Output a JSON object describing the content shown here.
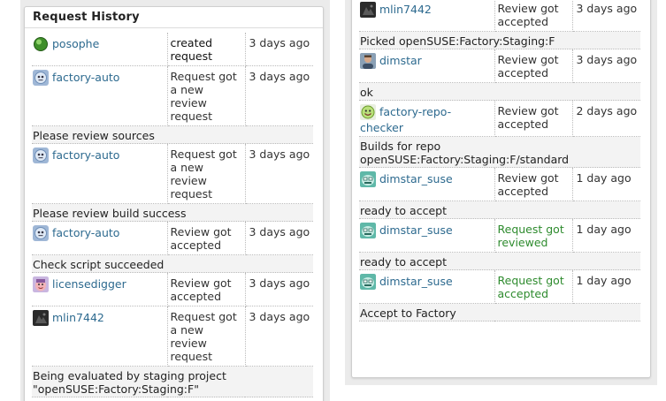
{
  "panel": {
    "title": "Request History"
  },
  "left_entries": [
    {
      "kind": "event",
      "user": "posophe",
      "avatar": "green-orb-icon",
      "desc": "created request",
      "desc_style": "dark",
      "when": "3 days ago"
    },
    {
      "kind": "event",
      "user": "factory-auto",
      "avatar": "bot-face-icon",
      "desc": "Request got a new review request",
      "desc_style": "",
      "when": "3 days ago"
    },
    {
      "kind": "comment",
      "text": "Please review sources"
    },
    {
      "kind": "event",
      "user": "factory-auto",
      "avatar": "bot-face-icon",
      "desc": "Request got a new review request",
      "desc_style": "",
      "when": "3 days ago"
    },
    {
      "kind": "comment",
      "text": "Please review build success"
    },
    {
      "kind": "event",
      "user": "factory-auto",
      "avatar": "bot-face-icon",
      "desc": "Review got accepted",
      "desc_style": "",
      "when": "3 days ago"
    },
    {
      "kind": "comment",
      "text": "Check script succeeded"
    },
    {
      "kind": "event",
      "user": "licensedigger",
      "avatar": "pink-face-icon",
      "desc": "Review got accepted",
      "desc_style": "",
      "when": "3 days ago"
    },
    {
      "kind": "event",
      "user": "mlin7442",
      "avatar": "dark-photo-icon",
      "desc": "Request got a new review request",
      "desc_style": "",
      "when": "3 days ago"
    },
    {
      "kind": "comment",
      "text": "Being evaluated by staging project \"openSUSE:Factory:Staging:F\""
    }
  ],
  "right_entries": [
    {
      "kind": "event",
      "user": "mlin7442",
      "avatar": "dark-photo-icon",
      "desc": "Review got accepted",
      "desc_style": "",
      "when": "3 days ago"
    },
    {
      "kind": "comment",
      "text": "Picked openSUSE:Factory:Staging:F"
    },
    {
      "kind": "event",
      "user": "dimstar",
      "avatar": "person-photo-icon",
      "desc": "Review got accepted",
      "desc_style": "",
      "when": "3 days ago"
    },
    {
      "kind": "comment",
      "text": "ok"
    },
    {
      "kind": "event",
      "user": "factory-repo-checker",
      "avatar": "green-smiley-icon",
      "desc": "Review got accepted",
      "desc_style": "",
      "when": "2 days ago"
    },
    {
      "kind": "comment",
      "text": "Builds for repo openSUSE:Factory:Staging:F/standard"
    },
    {
      "kind": "event",
      "user": "dimstar_suse",
      "avatar": "teal-face-icon",
      "desc": "Review got accepted",
      "desc_style": "",
      "when": "1 day ago"
    },
    {
      "kind": "comment",
      "text": "ready to accept"
    },
    {
      "kind": "event",
      "user": "dimstar_suse",
      "avatar": "teal-face-icon",
      "desc": "Request got reviewed",
      "desc_style": "green",
      "when": "1 day ago"
    },
    {
      "kind": "comment",
      "text": "ready to accept"
    },
    {
      "kind": "event",
      "user": "dimstar_suse",
      "avatar": "teal-face-icon",
      "desc": "Request got accepted",
      "desc_style": "green",
      "when": "1 day ago"
    },
    {
      "kind": "comment",
      "text": "Accept to Factory"
    }
  ],
  "colors": {
    "link": "#2d6a8f",
    "accepted_green": "#2e8b2e",
    "panel_bg": "#ebebeb"
  }
}
